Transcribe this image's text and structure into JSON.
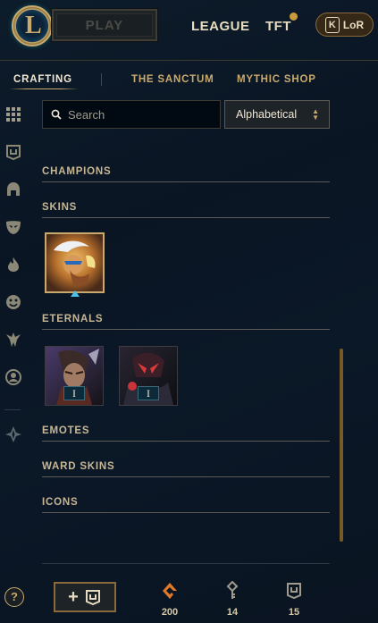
{
  "header": {
    "play_label": "PLAY",
    "nav": {
      "league": "LEAGUE",
      "tft": "TFT"
    },
    "lor_label": "LoR",
    "lor_badge": "K"
  },
  "subtabs": {
    "crafting": "CRAFTING",
    "sanctum": "THE SANCTUM",
    "mythic_shop": "MYTHIC SHOP"
  },
  "search": {
    "placeholder": "Search",
    "sort": "Alphabetical"
  },
  "sections": {
    "champions": "CHAMPIONS",
    "skins": "SKINS",
    "eternals": "ETERNALS",
    "emotes": "EMOTES",
    "ward_skins": "WARD SKINS",
    "icons": "ICONS"
  },
  "eternals": [
    {
      "rank": "I"
    },
    {
      "rank": "I"
    }
  ],
  "sidebar_icons": [
    "grid-icon",
    "chest-icon",
    "helmet-icon",
    "mask-icon",
    "flame-icon",
    "emote-face-icon",
    "ward-icon",
    "profile-icon",
    "mythic-icon"
  ],
  "bottom": {
    "help": "?",
    "add_plus": "+",
    "currencies": [
      {
        "icon": "orange-essence-icon",
        "amount": "200"
      },
      {
        "icon": "key-fragment-icon",
        "amount": "14"
      },
      {
        "icon": "chest-icon",
        "amount": "15"
      }
    ]
  },
  "colors": {
    "gold": "#c8aa6e",
    "background": "#0a1523",
    "essence": "#e07a2a"
  }
}
